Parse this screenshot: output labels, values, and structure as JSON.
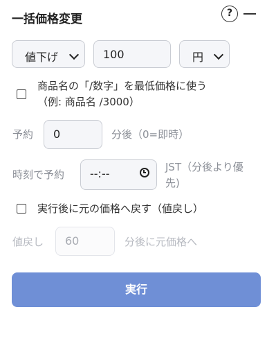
{
  "header": {
    "title": "一括価格変更",
    "help_label": "?"
  },
  "controls": {
    "direction_value": "値下げ",
    "amount_value": "100",
    "unit_value": "円"
  },
  "min_price_option": {
    "label_line1": "商品名の「/数字」を最低価格に使う",
    "label_line2": "（例: 商品名 /3000）",
    "checked": false
  },
  "schedule": {
    "label": "予約",
    "minutes_value": "0",
    "suffix": "分後（0=即時）"
  },
  "time_schedule": {
    "label": "時刻で予約",
    "time_value": "--:--",
    "note_line1": "JST（分後より優",
    "note_line2": "先)"
  },
  "revert_option": {
    "label": "実行後に元の価格へ戻す（値戻し）",
    "checked": false
  },
  "revert": {
    "label": "値戻し",
    "minutes_placeholder": "60",
    "suffix": "分後に元価格へ"
  },
  "actions": {
    "run_label": "実行"
  }
}
